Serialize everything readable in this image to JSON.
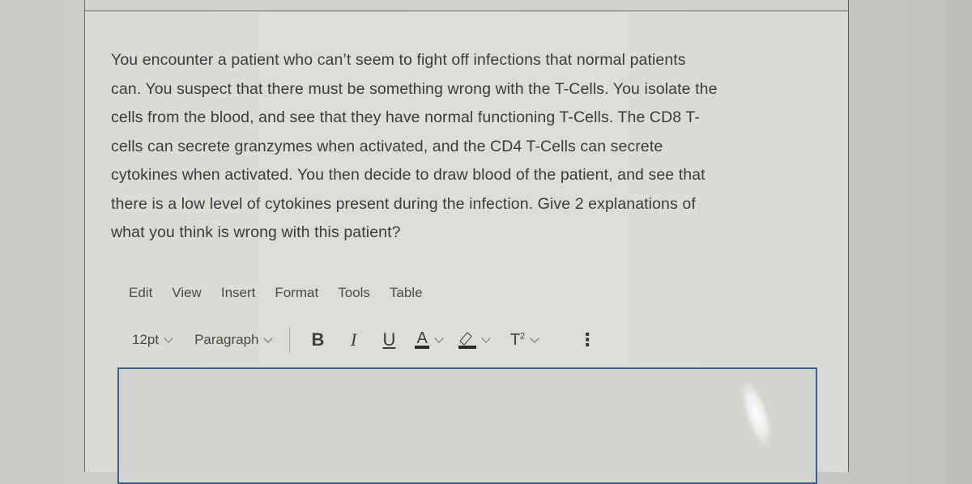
{
  "question": {
    "lines": [
      "You encounter a patient who can’t seem to fight off infections that normal patients",
      "can. You suspect that there must be something wrong with the T-Cells. You isolate the",
      "cells from the blood, and see that they have normal functioning T-Cells. The CD8 T-",
      "cells can secrete granzymes when activated, and the CD4 T-Cells can secrete",
      "cytokines when activated. You then decide to draw blood of the patient, and see that",
      "there is a low level of cytokines present during the infection. Give 2 explanations of",
      "what you think is wrong with this patient?"
    ]
  },
  "editor": {
    "menu": [
      "Edit",
      "View",
      "Insert",
      "Format",
      "Tools",
      "Table"
    ],
    "toolbar": {
      "font_size": "12pt",
      "block_format": "Paragraph",
      "bold": "B",
      "italic": "I",
      "underline": "U",
      "text_color": "A",
      "superscript": "T",
      "superscript_mark": "2",
      "more": "⋮"
    },
    "content": ""
  }
}
